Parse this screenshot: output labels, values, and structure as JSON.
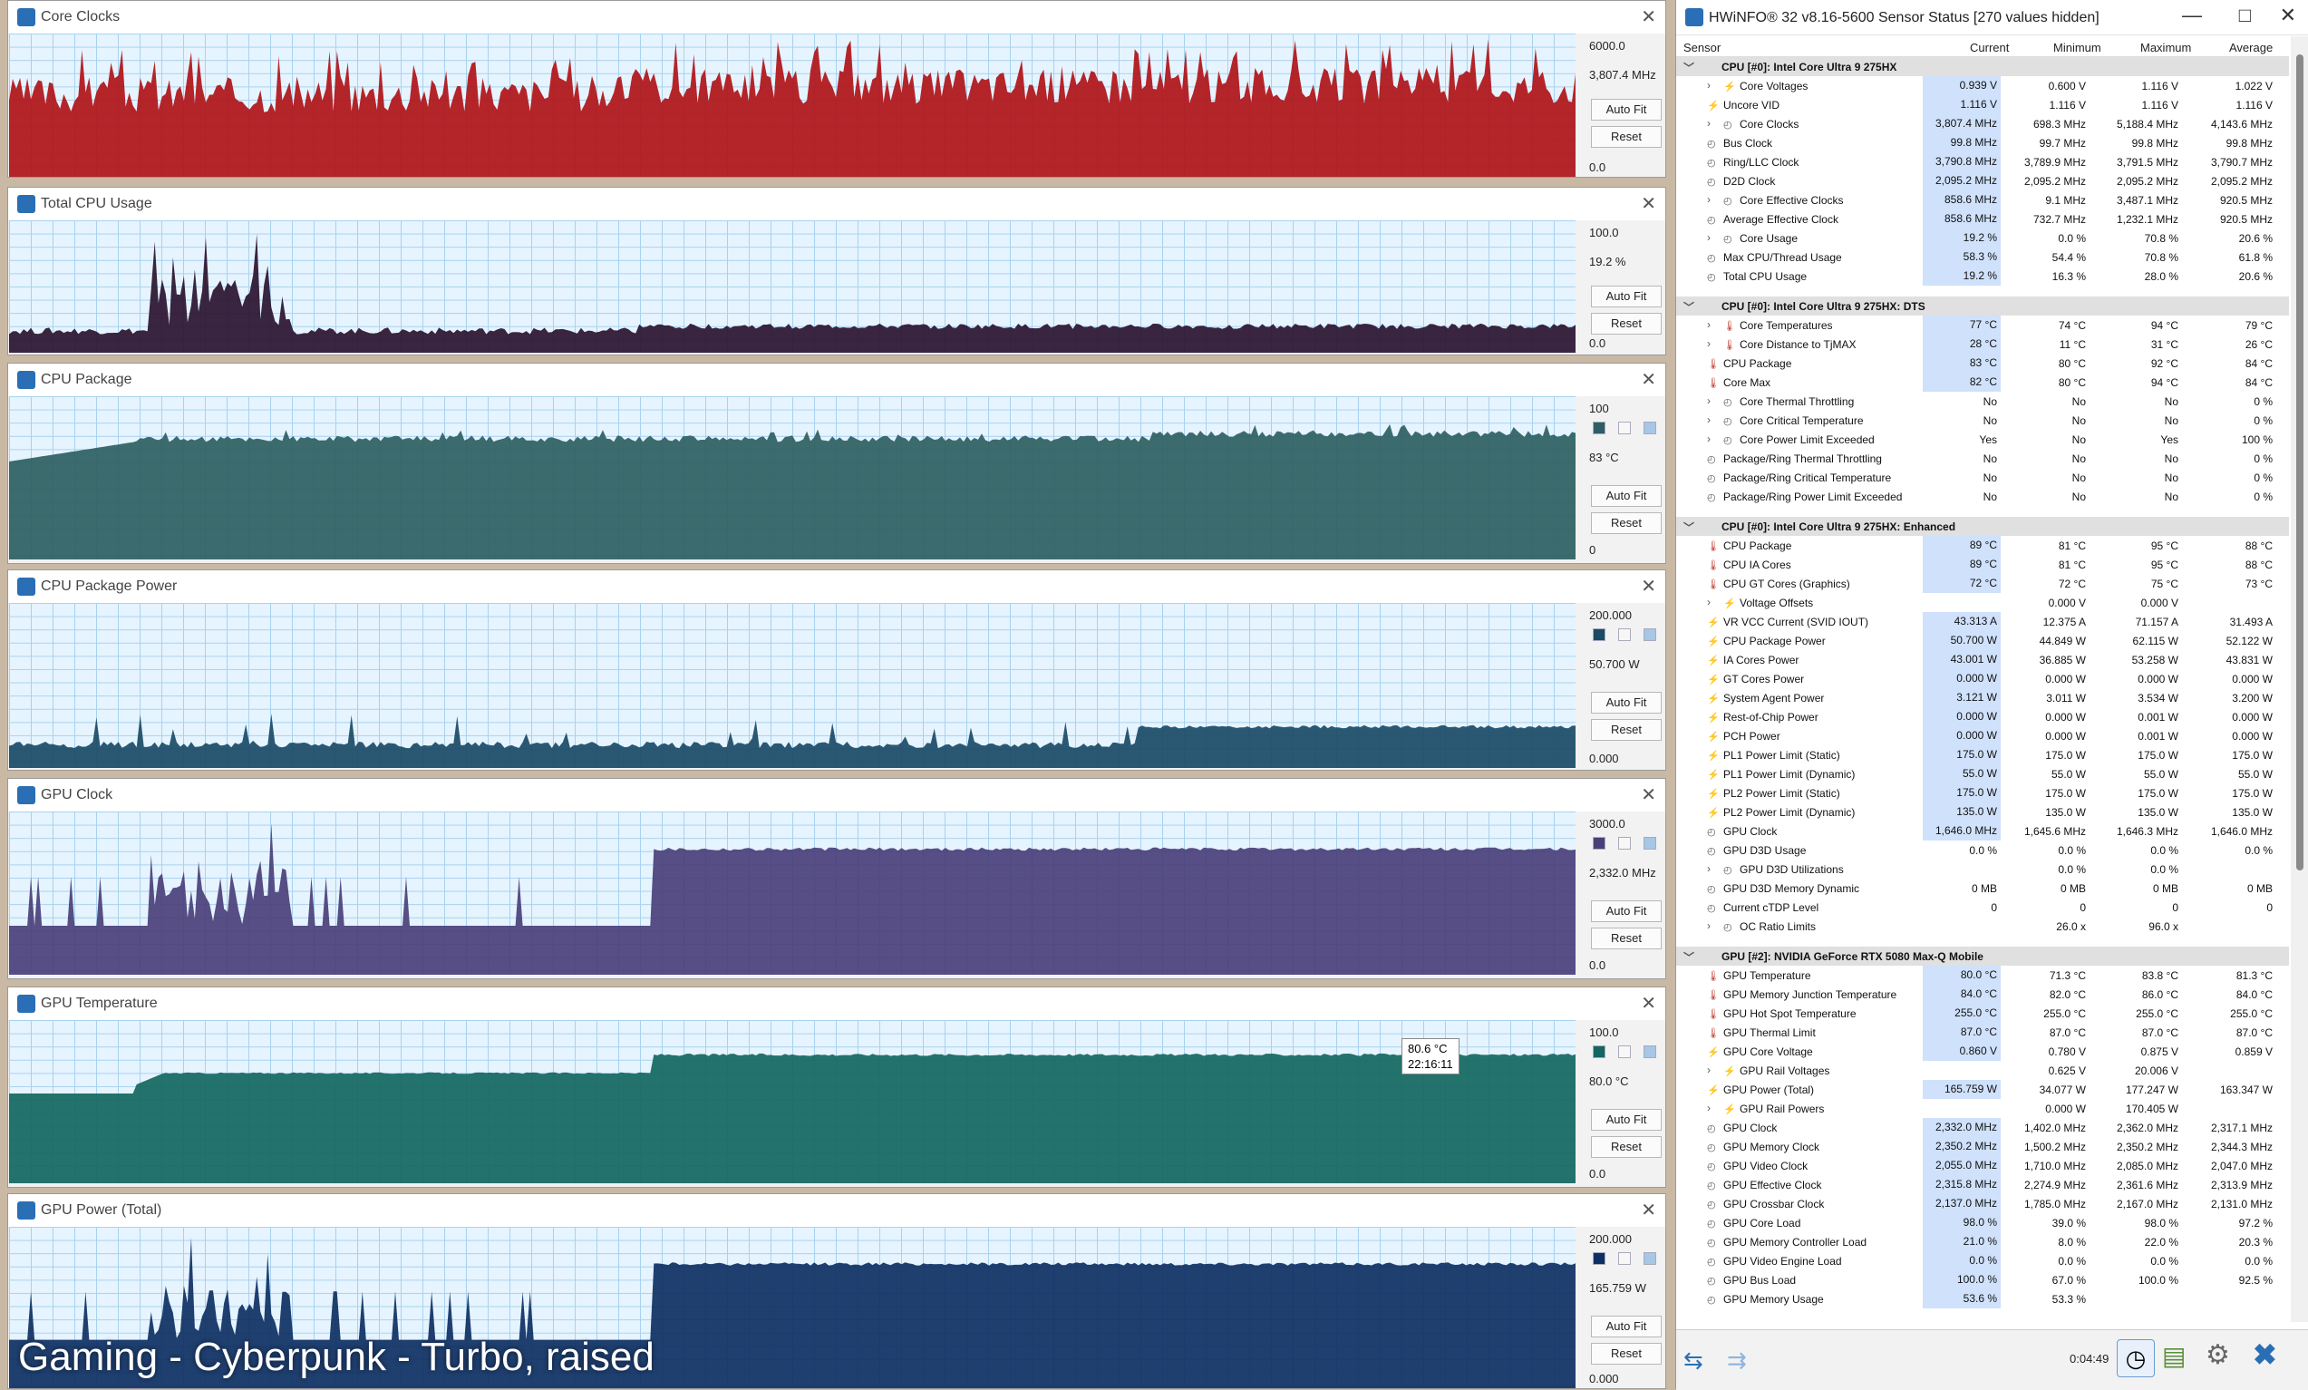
{
  "graphs": [
    {
      "title": "Core Clocks",
      "max_label": "6000.0",
      "cur_label": "3,807.4 MHz",
      "min_label": "0.0",
      "color": "#b01218",
      "level": 0.62,
      "profile": "noisy",
      "range": [
        0,
        6000
      ]
    },
    {
      "title": "Total CPU Usage",
      "max_label": "100.0",
      "cur_label": "19.2 %",
      "min_label": "0.0",
      "color": "#2a1230",
      "level": 0.2,
      "profile": "usage",
      "range": [
        0,
        100
      ]
    },
    {
      "title": "CPU Package",
      "max_label": "100",
      "cur_label": "83 °C",
      "min_label": "0",
      "color": "#2e5e62",
      "level": 0.8,
      "profile": "flat",
      "range": [
        0,
        100
      ],
      "swatch": true
    },
    {
      "title": "CPU Package Power",
      "max_label": "200.000",
      "cur_label": "50.700 W",
      "min_label": "0.000",
      "color": "#1a4a66",
      "level": 0.2,
      "profile": "power",
      "range": [
        0,
        200
      ],
      "swatch": true
    },
    {
      "title": "GPU Clock",
      "max_label": "3000.0",
      "cur_label": "2,332.0 MHz",
      "min_label": "0.0",
      "color": "#4a3f7a",
      "level": 0.78,
      "profile": "step",
      "range": [
        0,
        3000
      ],
      "swatch": true
    },
    {
      "title": "GPU Temperature",
      "max_label": "100.0",
      "cur_label": "80.0 °C",
      "min_label": "0.0",
      "color": "#136660",
      "level": 0.8,
      "profile": "gputemp",
      "range": [
        0,
        100
      ],
      "swatch": true
    },
    {
      "title": "GPU Power (Total)",
      "max_label": "200.000",
      "cur_label": "165.759 W",
      "min_label": "0.000",
      "color": "#0e2f63",
      "level": 0.83,
      "profile": "step",
      "range": [
        0,
        200
      ],
      "swatch": true
    }
  ],
  "buttons": {
    "autofit": "Auto Fit",
    "reset": "Reset"
  },
  "tooltip": {
    "value": "80.6 °C",
    "time": "22:16:11"
  },
  "watermark": "Gaming - Cyberpunk - Turbo, raised",
  "hwinfo": {
    "title": "HWiNFO® 32 v8.16-5600 Sensor Status [270 values hidden]",
    "columns": [
      "Sensor",
      "Current",
      "Minimum",
      "Maximum",
      "Average"
    ],
    "rows": [
      {
        "g": "CPU [#0]: Intel Core Ultra 9 275HX"
      },
      {
        "n": "Core Voltages",
        "i": "v",
        "e": 1,
        "s": 1,
        "c": "0.939 V",
        "mn": "0.600 V",
        "mx": "1.116 V",
        "a": "1.022 V"
      },
      {
        "n": "Uncore VID",
        "i": "v",
        "c": "1.116 V",
        "mn": "1.116 V",
        "mx": "1.116 V",
        "a": "1.116 V"
      },
      {
        "n": "Core Clocks",
        "i": "c",
        "e": 1,
        "s": 1,
        "c": "3,807.4 MHz",
        "mn": "698.3 MHz",
        "mx": "5,188.4 MHz",
        "a": "4,143.6 MHz"
      },
      {
        "n": "Bus Clock",
        "i": "c",
        "c": "99.8 MHz",
        "mn": "99.7 MHz",
        "mx": "99.8 MHz",
        "a": "99.8 MHz"
      },
      {
        "n": "Ring/LLC Clock",
        "i": "c",
        "c": "3,790.8 MHz",
        "mn": "3,789.9 MHz",
        "mx": "3,791.5 MHz",
        "a": "3,790.7 MHz"
      },
      {
        "n": "D2D Clock",
        "i": "c",
        "c": "2,095.2 MHz",
        "mn": "2,095.2 MHz",
        "mx": "2,095.2 MHz",
        "a": "2,095.2 MHz"
      },
      {
        "n": "Core Effective Clocks",
        "i": "c",
        "e": 1,
        "s": 1,
        "c": "858.6 MHz",
        "mn": "9.1 MHz",
        "mx": "3,487.1 MHz",
        "a": "920.5 MHz"
      },
      {
        "n": "Average Effective Clock",
        "i": "c",
        "c": "858.6 MHz",
        "mn": "732.7 MHz",
        "mx": "1,232.1 MHz",
        "a": "920.5 MHz"
      },
      {
        "n": "Core Usage",
        "i": "c",
        "e": 1,
        "s": 1,
        "c": "19.2 %",
        "mn": "0.0 %",
        "mx": "70.8 %",
        "a": "20.6 %"
      },
      {
        "n": "Max CPU/Thread Usage",
        "i": "c",
        "c": "58.3 %",
        "mn": "54.4 %",
        "mx": "70.8 %",
        "a": "61.8 %"
      },
      {
        "n": "Total CPU Usage",
        "i": "c",
        "c": "19.2 %",
        "mn": "16.3 %",
        "mx": "28.0 %",
        "a": "20.6 %"
      },
      {
        "sp": 1
      },
      {
        "g": "CPU [#0]: Intel Core Ultra 9 275HX: DTS"
      },
      {
        "n": "Core Temperatures",
        "i": "t",
        "e": 1,
        "s": 1,
        "c": "77 °C",
        "mn": "74 °C",
        "mx": "94 °C",
        "a": "79 °C"
      },
      {
        "n": "Core Distance to TjMAX",
        "i": "t",
        "e": 1,
        "s": 1,
        "c": "28 °C",
        "mn": "11 °C",
        "mx": "31 °C",
        "a": "26 °C"
      },
      {
        "n": "CPU Package",
        "i": "t",
        "c": "83 °C",
        "mn": "80 °C",
        "mx": "92 °C",
        "a": "84 °C"
      },
      {
        "n": "Core Max",
        "i": "t",
        "c": "82 °C",
        "mn": "80 °C",
        "mx": "94 °C",
        "a": "84 °C"
      },
      {
        "n": "Core Thermal Throttling",
        "i": "c",
        "e": 1,
        "s": 1,
        "c": "No",
        "mn": "No",
        "mx": "No",
        "a": "0 %",
        "nb": 1
      },
      {
        "n": "Core Critical Temperature",
        "i": "c",
        "e": 1,
        "s": 1,
        "c": "No",
        "mn": "No",
        "mx": "No",
        "a": "0 %",
        "nb": 1
      },
      {
        "n": "Core Power Limit Exceeded",
        "i": "c",
        "e": 1,
        "s": 1,
        "c": "Yes",
        "mn": "No",
        "mx": "Yes",
        "a": "100 %",
        "nb": 1
      },
      {
        "n": "Package/Ring Thermal Throttling",
        "i": "c",
        "c": "No",
        "mn": "No",
        "mx": "No",
        "a": "0 %",
        "nb": 1
      },
      {
        "n": "Package/Ring Critical Temperature",
        "i": "c",
        "c": "No",
        "mn": "No",
        "mx": "No",
        "a": "0 %",
        "nb": 1
      },
      {
        "n": "Package/Ring Power Limit Exceeded",
        "i": "c",
        "c": "No",
        "mn": "No",
        "mx": "No",
        "a": "0 %",
        "nb": 1
      },
      {
        "sp": 1
      },
      {
        "g": "CPU [#0]: Intel Core Ultra 9 275HX: Enhanced"
      },
      {
        "n": "CPU Package",
        "i": "t",
        "c": "89 °C",
        "mn": "81 °C",
        "mx": "95 °C",
        "a": "88 °C"
      },
      {
        "n": "CPU IA Cores",
        "i": "t",
        "c": "89 °C",
        "mn": "81 °C",
        "mx": "95 °C",
        "a": "88 °C"
      },
      {
        "n": "CPU GT Cores (Graphics)",
        "i": "t",
        "c": "72 °C",
        "mn": "72 °C",
        "mx": "75 °C",
        "a": "73 °C"
      },
      {
        "n": "Voltage Offsets",
        "i": "v",
        "e": 1,
        "s": 1,
        "c": "",
        "mn": "0.000 V",
        "mx": "0.000 V",
        "a": "",
        "nb": 1
      },
      {
        "n": "VR VCC Current (SVID IOUT)",
        "i": "v",
        "c": "43.313 A",
        "mn": "12.375 A",
        "mx": "71.157 A",
        "a": "31.493 A"
      },
      {
        "n": "CPU Package Power",
        "i": "v",
        "c": "50.700 W",
        "mn": "44.849 W",
        "mx": "62.115 W",
        "a": "52.122 W"
      },
      {
        "n": "IA Cores Power",
        "i": "v",
        "c": "43.001 W",
        "mn": "36.885 W",
        "mx": "53.258 W",
        "a": "43.831 W"
      },
      {
        "n": "GT Cores Power",
        "i": "v",
        "c": "0.000 W",
        "mn": "0.000 W",
        "mx": "0.000 W",
        "a": "0.000 W"
      },
      {
        "n": "System Agent Power",
        "i": "v",
        "c": "3.121 W",
        "mn": "3.011 W",
        "mx": "3.534 W",
        "a": "3.200 W"
      },
      {
        "n": "Rest-of-Chip Power",
        "i": "v",
        "c": "0.000 W",
        "mn": "0.000 W",
        "mx": "0.001 W",
        "a": "0.000 W"
      },
      {
        "n": "PCH Power",
        "i": "v",
        "c": "0.000 W",
        "mn": "0.000 W",
        "mx": "0.001 W",
        "a": "0.000 W"
      },
      {
        "n": "PL1 Power Limit (Static)",
        "i": "v",
        "c": "175.0 W",
        "mn": "175.0 W",
        "mx": "175.0 W",
        "a": "175.0 W"
      },
      {
        "n": "PL1 Power Limit (Dynamic)",
        "i": "v",
        "c": "55.0 W",
        "mn": "55.0 W",
        "mx": "55.0 W",
        "a": "55.0 W"
      },
      {
        "n": "PL2 Power Limit (Static)",
        "i": "v",
        "c": "175.0 W",
        "mn": "175.0 W",
        "mx": "175.0 W",
        "a": "175.0 W"
      },
      {
        "n": "PL2 Power Limit (Dynamic)",
        "i": "v",
        "c": "135.0 W",
        "mn": "135.0 W",
        "mx": "135.0 W",
        "a": "135.0 W"
      },
      {
        "n": "GPU Clock",
        "i": "c",
        "c": "1,646.0 MHz",
        "mn": "1,645.6 MHz",
        "mx": "1,646.3 MHz",
        "a": "1,646.0 MHz"
      },
      {
        "n": "GPU D3D Usage",
        "i": "c",
        "c": "0.0 %",
        "mn": "0.0 %",
        "mx": "0.0 %",
        "a": "0.0 %",
        "nb": 1
      },
      {
        "n": "GPU D3D Utilizations",
        "i": "c",
        "e": 1,
        "s": 1,
        "c": "",
        "mn": "0.0 %",
        "mx": "0.0 %",
        "a": "",
        "nb": 1
      },
      {
        "n": "GPU D3D Memory Dynamic",
        "i": "c",
        "c": "0 MB",
        "mn": "0 MB",
        "mx": "0 MB",
        "a": "0 MB",
        "nb": 1
      },
      {
        "n": "Current cTDP Level",
        "i": "c",
        "c": "0",
        "mn": "0",
        "mx": "0",
        "a": "0",
        "nb": 1
      },
      {
        "n": "OC Ratio Limits",
        "i": "c",
        "e": 1,
        "s": 1,
        "c": "",
        "mn": "26.0 x",
        "mx": "96.0 x",
        "a": "",
        "nb": 1
      },
      {
        "sp": 1
      },
      {
        "g": "GPU [#2]: NVIDIA  GeForce RTX 5080 Max-Q Mobile"
      },
      {
        "n": "GPU Temperature",
        "i": "t",
        "c": "80.0 °C",
        "mn": "71.3 °C",
        "mx": "83.8 °C",
        "a": "81.3 °C"
      },
      {
        "n": "GPU Memory Junction Temperature",
        "i": "t",
        "c": "84.0 °C",
        "mn": "82.0 °C",
        "mx": "86.0 °C",
        "a": "84.0 °C"
      },
      {
        "n": "GPU Hot Spot Temperature",
        "i": "t",
        "c": "255.0 °C",
        "mn": "255.0 °C",
        "mx": "255.0 °C",
        "a": "255.0 °C"
      },
      {
        "n": "GPU Thermal Limit",
        "i": "t",
        "c": "87.0 °C",
        "mn": "87.0 °C",
        "mx": "87.0 °C",
        "a": "87.0 °C"
      },
      {
        "n": "GPU Core Voltage",
        "i": "v",
        "c": "0.860 V",
        "mn": "0.780 V",
        "mx": "0.875 V",
        "a": "0.859 V"
      },
      {
        "n": "GPU Rail Voltages",
        "i": "v",
        "e": 1,
        "s": 1,
        "c": "",
        "mn": "0.625 V",
        "mx": "20.006 V",
        "a": "",
        "nb": 1
      },
      {
        "n": "GPU Power (Total)",
        "i": "v",
        "c": "165.759 W",
        "mn": "34.077 W",
        "mx": "177.247 W",
        "a": "163.347 W"
      },
      {
        "n": "GPU Rail Powers",
        "i": "v",
        "e": 1,
        "s": 1,
        "c": "",
        "mn": "0.000 W",
        "mx": "170.405 W",
        "a": "",
        "nb": 1
      },
      {
        "n": "GPU Clock",
        "i": "c",
        "c": "2,332.0 MHz",
        "mn": "1,402.0 MHz",
        "mx": "2,362.0 MHz",
        "a": "2,317.1 MHz"
      },
      {
        "n": "GPU Memory Clock",
        "i": "c",
        "c": "2,350.2 MHz",
        "mn": "1,500.2 MHz",
        "mx": "2,350.2 MHz",
        "a": "2,344.3 MHz"
      },
      {
        "n": "GPU Video Clock",
        "i": "c",
        "c": "2,055.0 MHz",
        "mn": "1,710.0 MHz",
        "mx": "2,085.0 MHz",
        "a": "2,047.0 MHz"
      },
      {
        "n": "GPU Effective Clock",
        "i": "c",
        "c": "2,315.8 MHz",
        "mn": "2,274.9 MHz",
        "mx": "2,361.6 MHz",
        "a": "2,313.9 MHz"
      },
      {
        "n": "GPU Crossbar Clock",
        "i": "c",
        "c": "2,137.0 MHz",
        "mn": "1,785.0 MHz",
        "mx": "2,167.0 MHz",
        "a": "2,131.0 MHz"
      },
      {
        "n": "GPU Core Load",
        "i": "c",
        "c": "98.0 %",
        "mn": "39.0 %",
        "mx": "98.0 %",
        "a": "97.2 %"
      },
      {
        "n": "GPU Memory Controller Load",
        "i": "c",
        "c": "21.0 %",
        "mn": "8.0 %",
        "mx": "22.0 %",
        "a": "20.3 %"
      },
      {
        "n": "GPU Video Engine Load",
        "i": "c",
        "c": "0.0 %",
        "mn": "0.0 %",
        "mx": "0.0 %",
        "a": "0.0 %"
      },
      {
        "n": "GPU Bus Load",
        "i": "c",
        "c": "100.0 %",
        "mn": "67.0 %",
        "mx": "100.0 %",
        "a": "92.5 %"
      },
      {
        "n": "GPU Memory Usage",
        "i": "c",
        "c": "53.6 %",
        "mn": "53.3 %",
        "mx": "",
        "a": ""
      }
    ],
    "footer": {
      "timer": "0:04:49"
    }
  }
}
